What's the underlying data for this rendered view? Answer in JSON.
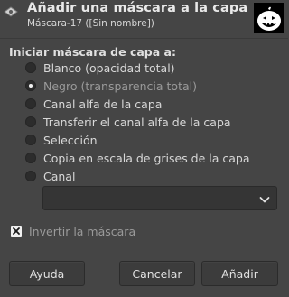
{
  "header": {
    "title": "Añadir una máscara a la capa",
    "subtitle": "Máscara-17 ([Sin nombre])",
    "icon": "gimp-icon",
    "thumbnail": "mask-preview-thumbnail"
  },
  "init_section": {
    "title": "Iniciar máscara de capa a:",
    "options": [
      {
        "label": "Blanco (opacidad total)",
        "selected": false,
        "enabled": true
      },
      {
        "label": "Negro (transparencia total)",
        "selected": true,
        "enabled": false
      },
      {
        "label": "Canal alfa de la capa",
        "selected": false,
        "enabled": true
      },
      {
        "label": "Transferir el canal alfa de la capa",
        "selected": false,
        "enabled": true
      },
      {
        "label": "Selección",
        "selected": false,
        "enabled": true
      },
      {
        "label": "Copia en escala de grises de la capa",
        "selected": false,
        "enabled": true
      },
      {
        "label": "Canal",
        "selected": false,
        "enabled": true
      }
    ],
    "channel_select_value": ""
  },
  "invert": {
    "label": "Invertir la máscara",
    "checked": true
  },
  "buttons": {
    "help": "Ayuda",
    "cancel": "Cancelar",
    "add": "Añadir"
  },
  "colors": {
    "background": "#454545",
    "text": "#dcdcdc",
    "disabled_text": "#9a9a9a"
  }
}
